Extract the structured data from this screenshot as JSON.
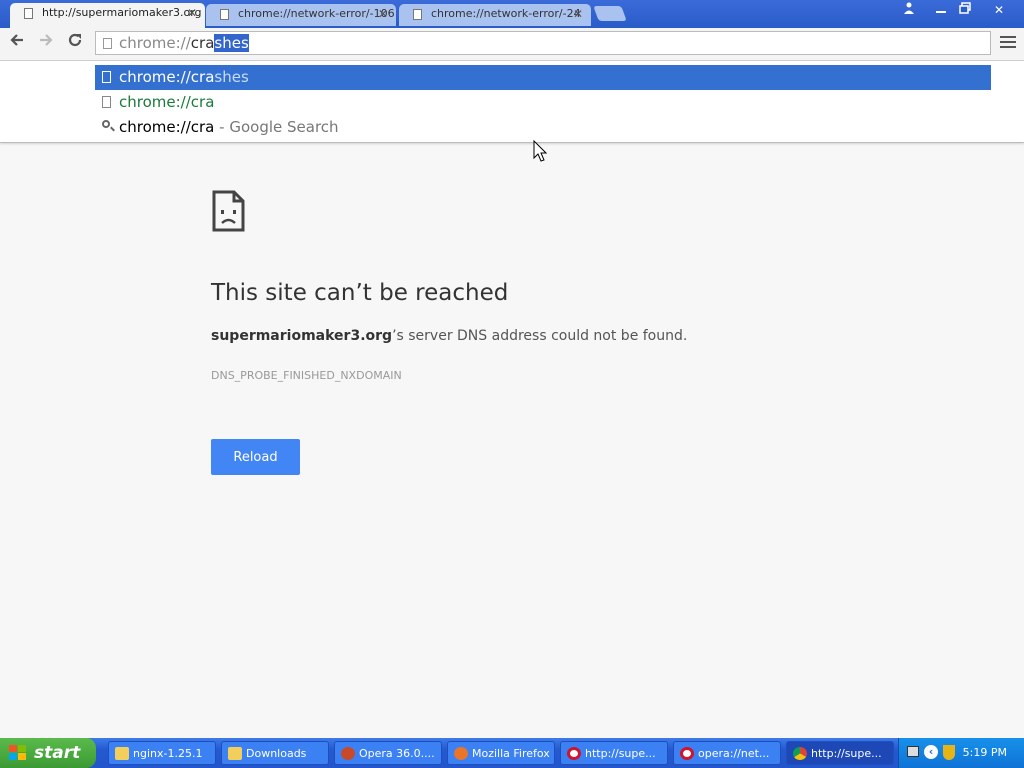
{
  "tabs": [
    {
      "title": "http://supermariomaker3.org",
      "active": true
    },
    {
      "title": "chrome://network-error/-106",
      "active": false
    },
    {
      "title": "chrome://network-error/-24",
      "active": false
    }
  ],
  "window_controls": {
    "user": "user-icon",
    "minimize": "minimize-icon",
    "restore": "restore-icon",
    "close": "close-icon"
  },
  "omnibox": {
    "scheme": "chrome://",
    "typed": "cra",
    "autocomplete": "shes"
  },
  "suggestions": [
    {
      "prefix": "chrome://",
      "match": "cra",
      "rest": "shes",
      "selected": true,
      "icon": "page-icon"
    },
    {
      "prefix": "chrome://",
      "match": "cra",
      "rest": "",
      "selected": false,
      "icon": "page-icon"
    },
    {
      "prefix": "chrome://cra",
      "match": "",
      "rest": " - Google Search",
      "selected": false,
      "icon": "search-icon"
    }
  ],
  "error": {
    "title": "This site can’t be reached",
    "domain": "supermariomaker3.org",
    "desc_rest": "’s server DNS address could not be found.",
    "code": "DNS_PROBE_FINISHED_NXDOMAIN",
    "reload_label": "Reload"
  },
  "taskbar": {
    "start_label": "start",
    "items": [
      {
        "label": "nginx-1.25.1",
        "icon": "folder-icon"
      },
      {
        "label": "Downloads",
        "icon": "folder-icon"
      },
      {
        "label": "Opera 36.0....",
        "icon": "opera-installer-icon"
      },
      {
        "label": "Mozilla Firefox",
        "icon": "firefox-icon"
      },
      {
        "label": "http://supe...",
        "icon": "opera-icon"
      },
      {
        "label": "opera://net...",
        "icon": "opera-icon"
      },
      {
        "label": "http://supe...",
        "icon": "chrome-icon",
        "active": true
      }
    ],
    "clock": "5:19 PM"
  },
  "colors": {
    "accent": "#4285f4",
    "selection": "#3370d0",
    "taskbar": "#2458cf",
    "start": "#3b9a33"
  }
}
